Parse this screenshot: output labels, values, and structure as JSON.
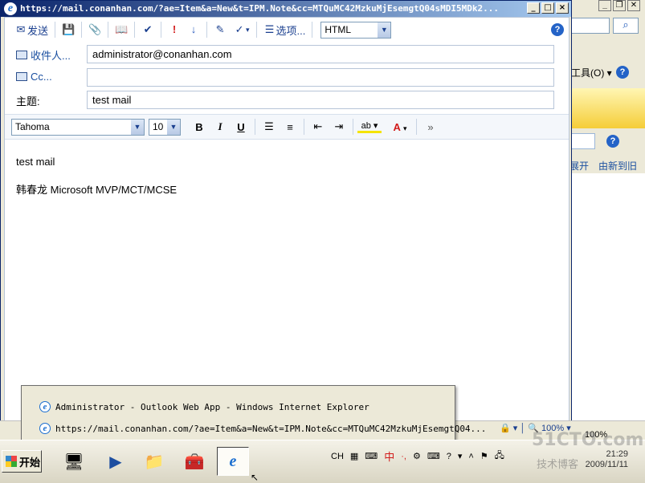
{
  "popup": {
    "title": "https://mail.conanhan.com/?ae=Item&a=New&t=IPM.Note&cc=MTQuMC42MzkuMjEsemgtQ04sMDI5MDk2...",
    "window_controls": [
      "_",
      "□",
      "×"
    ]
  },
  "toolbar": {
    "send_label": "发送",
    "options_label": "选项...",
    "format_value": "HTML",
    "icons": [
      "send-icon",
      "save-icon",
      "attach-icon",
      "address-book-icon",
      "check-names-icon",
      "importance-high-icon",
      "importance-low-icon",
      "signature-icon",
      "spellcheck-icon",
      "options-icon",
      "help-icon"
    ]
  },
  "fields": {
    "to_label": "收件人...",
    "to_value": "administrator@conanhan.com",
    "cc_label": "Cc...",
    "cc_value": "",
    "subject_label": "主题:",
    "subject_value": "test mail"
  },
  "format_bar": {
    "font": "Tahoma",
    "size": "10",
    "bold": "B",
    "italic": "I",
    "underline": "U",
    "highlight": "ab",
    "font_color": "A",
    "more": "»"
  },
  "message": {
    "line1": "test mail",
    "line2": "韩春龙  Microsoft MVP/MCT/MCSE"
  },
  "background_window": {
    "tools_label": "工具(O)",
    "link1": "展开",
    "link2": "由新到旧"
  },
  "taskbar_popup": {
    "item1": "Administrator - Outlook Web App - Windows Internet Explorer",
    "item2": "https://mail.conanhan.com/?ae=Item&a=New&t=IPM.Note&cc=MTQuMC42MzkuMjEsemgtQ04..."
  },
  "status": {
    "zoom": "100%"
  },
  "taskbar": {
    "start_label": "开始",
    "language": "CH",
    "ime": "中",
    "time": "21:29",
    "date": "2009/11/11"
  },
  "watermark": {
    "main": "51CTO.com",
    "sub": "技术博客"
  }
}
